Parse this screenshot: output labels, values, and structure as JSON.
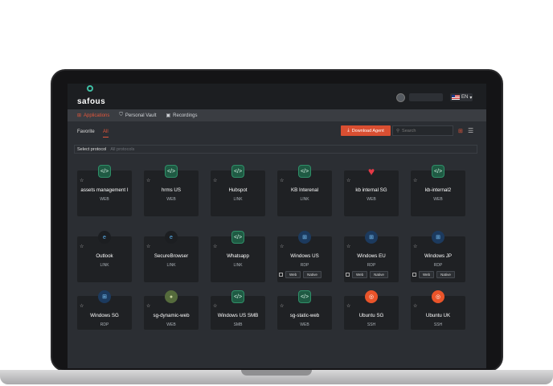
{
  "brand": {
    "name": "safous"
  },
  "header": {
    "lang": "EN"
  },
  "nav": {
    "tabs": [
      {
        "label": "Applications",
        "icon": "grid-icon"
      },
      {
        "label": "Personal Vault",
        "icon": "shield-icon"
      },
      {
        "label": "Recordings",
        "icon": "video-icon"
      }
    ]
  },
  "filters": {
    "favorite": "Favorite",
    "all": "All",
    "download": "Download Agent",
    "search_placeholder": "Search",
    "protocol_label": "Select protocol",
    "protocol_placeholder": "All protocols"
  },
  "apps": [
    {
      "title": "assets management I",
      "sub": "WEB",
      "icon": "web"
    },
    {
      "title": "hrms US",
      "sub": "WEB",
      "icon": "web"
    },
    {
      "title": "Hubspot",
      "sub": "LINK",
      "icon": "web"
    },
    {
      "title": "KB Interenal",
      "sub": "LINK",
      "icon": "web"
    },
    {
      "title": "kb internal SG",
      "sub": "WEB",
      "icon": "heart"
    },
    {
      "title": "kb-internal2",
      "sub": "WEB",
      "icon": "web"
    },
    {
      "title": "Outlook",
      "sub": "LINK",
      "icon": "ie"
    },
    {
      "title": "SecureBrowser",
      "sub": "LINK",
      "icon": "ie"
    },
    {
      "title": "Whatsapp",
      "sub": "LINK",
      "icon": "web"
    },
    {
      "title": "Windows US",
      "sub": "RDP",
      "icon": "win",
      "actions": [
        "Web",
        "Native"
      ]
    },
    {
      "title": "Windows EU",
      "sub": "RDP",
      "icon": "win",
      "actions": [
        "Web",
        "Native"
      ]
    },
    {
      "title": "Windows JP",
      "sub": "RDP",
      "icon": "win",
      "actions": [
        "Web",
        "Native"
      ]
    },
    {
      "title": "Windows SG",
      "sub": "RDP",
      "icon": "win"
    },
    {
      "title": "sg-dynamic-web",
      "sub": "WEB",
      "icon": "photo"
    },
    {
      "title": "Windows US SMB",
      "sub": "SMB",
      "icon": "web"
    },
    {
      "title": "sg-static-web",
      "sub": "WEB",
      "icon": "web"
    },
    {
      "title": "Ubuntu SG",
      "sub": "SSH",
      "icon": "ubuntu"
    },
    {
      "title": "Ubuntu UK",
      "sub": "SSH",
      "icon": "ubuntu"
    }
  ]
}
